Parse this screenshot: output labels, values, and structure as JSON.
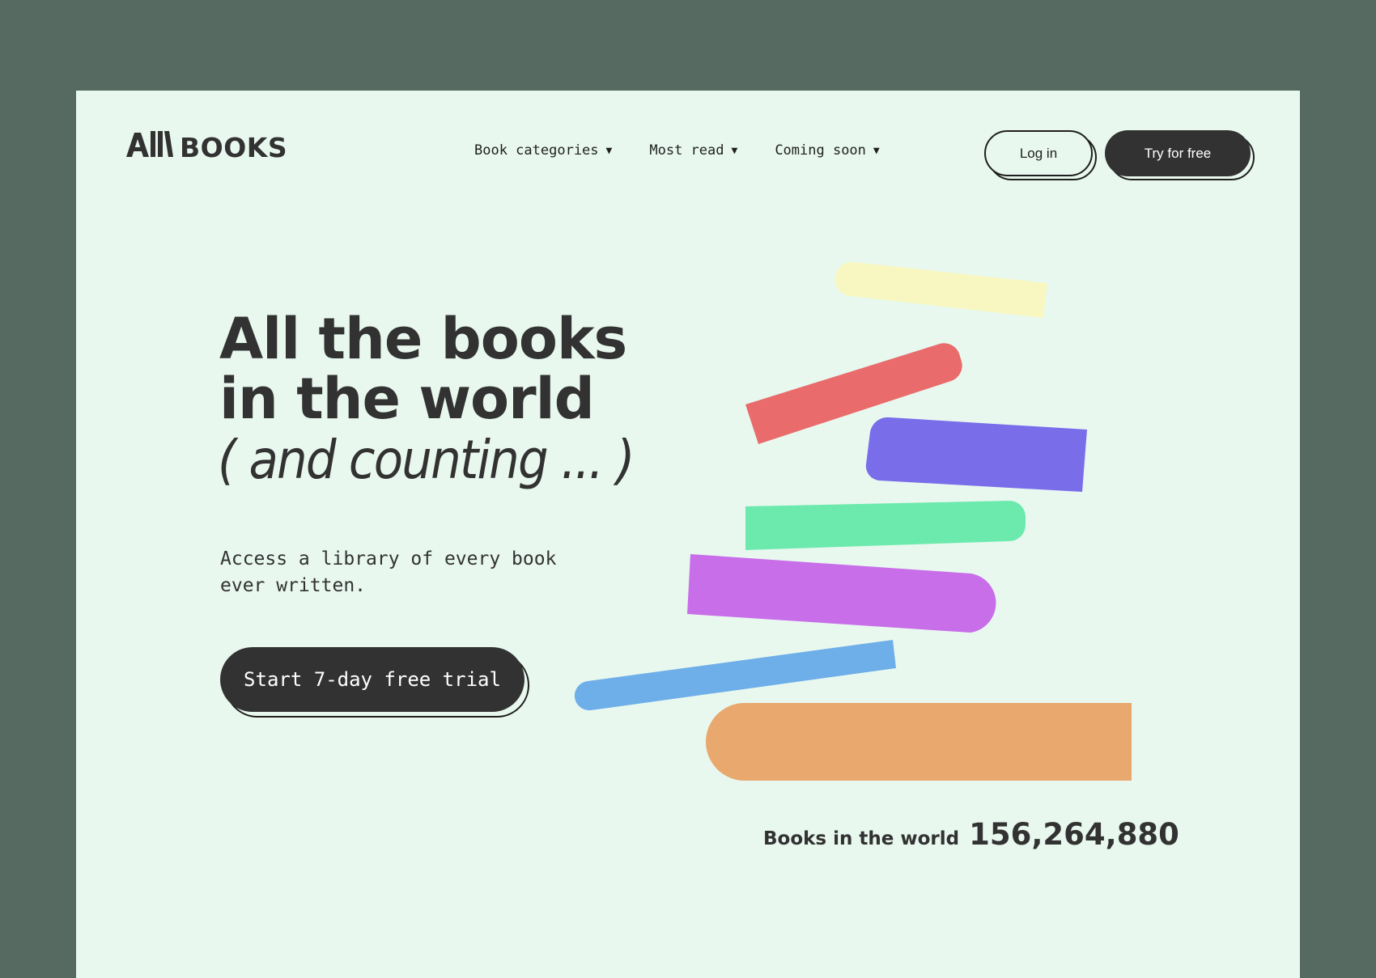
{
  "brand": {
    "logo_mark": "A||\\",
    "logo_text": "BOOKS"
  },
  "nav": {
    "items": [
      {
        "label": "Book categories",
        "caret": "▼"
      },
      {
        "label": "Most read",
        "caret": "▼"
      },
      {
        "label": "Coming soon",
        "caret": "▼"
      }
    ]
  },
  "header_actions": {
    "login_label": "Log in",
    "trial_label": "Try for free"
  },
  "hero": {
    "headline_line1": "All the books",
    "headline_line2": "in the world",
    "subhead": "( and counting ... )",
    "description": "Access a library of every book ever written.",
    "cta_label": "Start 7-day free trial"
  },
  "stats": {
    "label": "Books in the world",
    "value": "156,264,880"
  },
  "colors": {
    "frame": "#566a61",
    "page_background": "#e8f8ef",
    "ink": "#323232",
    "book_yellow": "#f8f7c1",
    "book_red": "#e96b6b",
    "book_indigo": "#796de9",
    "book_green": "#6ceaad",
    "book_violet": "#c86ee9",
    "book_blue": "#6eaee9",
    "book_orange": "#e9a86e"
  }
}
